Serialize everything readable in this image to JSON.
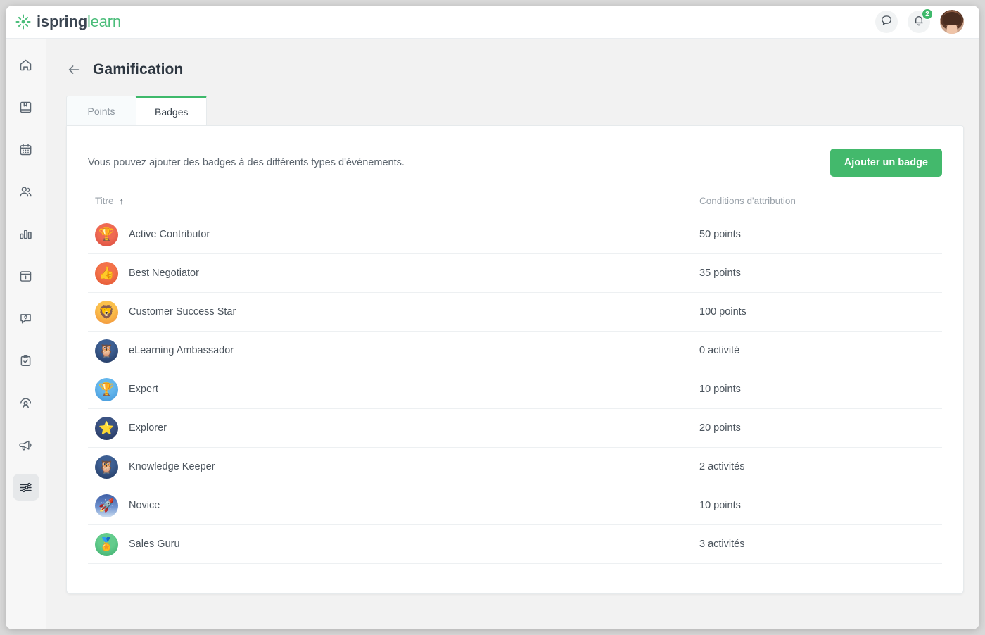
{
  "brand": {
    "part1": "ispring",
    "part2": "learn",
    "mark_icon": "ispring-logo-icon"
  },
  "topbar": {
    "chat_icon": "chat-bubble-icon",
    "bell_icon": "notification-bell-icon",
    "notification_count": "2",
    "avatar_icon": "user-avatar"
  },
  "sidebar": {
    "items": [
      {
        "name": "home",
        "icon": "home-icon",
        "active": false
      },
      {
        "name": "courses",
        "icon": "book-bookmark-icon",
        "active": false
      },
      {
        "name": "calendar",
        "icon": "calendar-icon",
        "active": false
      },
      {
        "name": "users",
        "icon": "users-icon",
        "active": false
      },
      {
        "name": "reports",
        "icon": "bar-chart-icon",
        "active": false
      },
      {
        "name": "news",
        "icon": "info-panel-icon",
        "active": false
      },
      {
        "name": "support",
        "icon": "question-bubble-icon",
        "active": false
      },
      {
        "name": "tasks",
        "icon": "clipboard-check-icon",
        "active": false
      },
      {
        "name": "performance",
        "icon": "user-gauge-icon",
        "active": false
      },
      {
        "name": "announcements",
        "icon": "megaphone-icon",
        "active": false
      },
      {
        "name": "settings",
        "icon": "sliders-icon",
        "active": true
      }
    ]
  },
  "page": {
    "back_icon": "back-arrow-icon",
    "title": "Gamification"
  },
  "tabs": [
    {
      "label": "Points",
      "active": false
    },
    {
      "label": "Badges",
      "active": true
    }
  ],
  "main": {
    "description": "Vous pouvez ajouter des badges à des différents types d'événements.",
    "add_button_label": "Ajouter un badge",
    "accent_color": "#43b96c"
  },
  "table": {
    "columns": {
      "title": "Titre",
      "title_sort_icon": "sort-ascending-arrow-icon",
      "title_sort_direction": "asc",
      "condition": "Conditions d'attribution"
    },
    "rows": [
      {
        "title": "Active Contributor",
        "condition": "50 points",
        "icon": "trophy-gem-badge-icon",
        "icon_class": "bi-trophy-red",
        "glyph": "🏆"
      },
      {
        "title": "Best Negotiator",
        "condition": "35 points",
        "icon": "thumbs-up-badge-icon",
        "icon_class": "bi-thumb-orange",
        "glyph": "👍"
      },
      {
        "title": "Customer Success Star",
        "condition": "100 points",
        "icon": "crowned-lion-badge-icon",
        "icon_class": "bi-lion-orange",
        "glyph": "🦁"
      },
      {
        "title": "eLearning Ambassador",
        "condition": "0 activité",
        "icon": "owl-badge-icon",
        "icon_class": "bi-owl-navy",
        "glyph": "🦉"
      },
      {
        "title": "Expert",
        "condition": "10 points",
        "icon": "silver-cup-badge-icon",
        "icon_class": "bi-cup-blue",
        "glyph": "🏆"
      },
      {
        "title": "Explorer",
        "condition": "20 points",
        "icon": "shooting-star-badge-icon",
        "icon_class": "bi-star-navy",
        "glyph": "⭐"
      },
      {
        "title": "Knowledge Keeper",
        "condition": "2 activités",
        "icon": "owl-badge-icon",
        "icon_class": "bi-owl-navy",
        "glyph": "🦉"
      },
      {
        "title": "Novice",
        "condition": "10 points",
        "icon": "rocket-badge-icon",
        "icon_class": "bi-rocket-blue",
        "glyph": "🚀"
      },
      {
        "title": "Sales Guru",
        "condition": "3 activités",
        "icon": "gold-medal-badge-icon",
        "icon_class": "bi-medal-green",
        "glyph": "🏅"
      }
    ]
  }
}
